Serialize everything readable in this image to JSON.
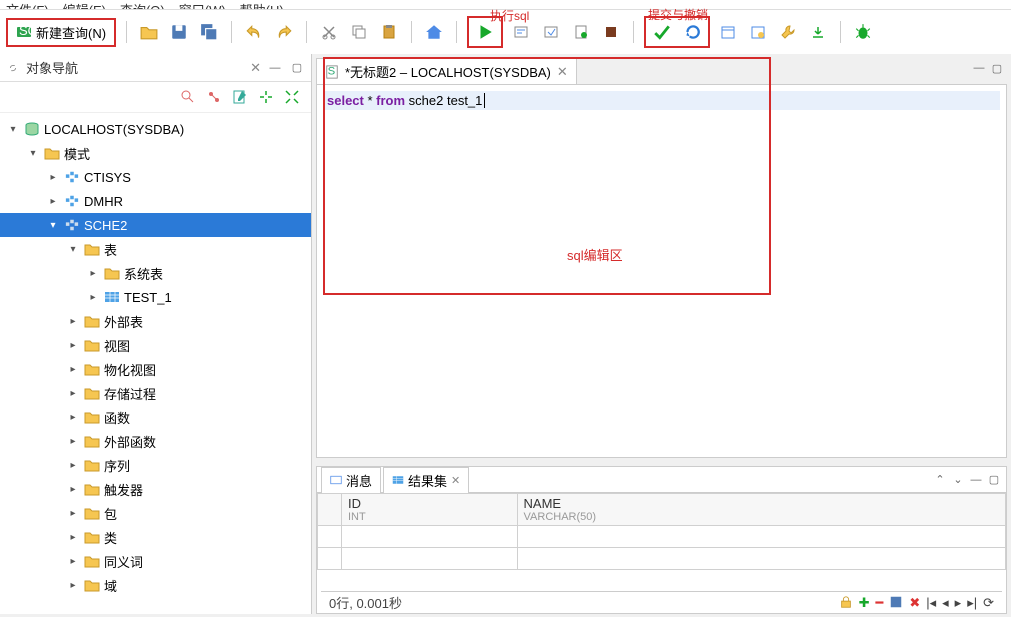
{
  "menu": [
    "文件(F)",
    "编辑(E)",
    "查询(Q)",
    "窗口(W)",
    "帮助(H)"
  ],
  "toolbar": {
    "new_query": "新建查询(N)"
  },
  "annotations": {
    "exec": "执行sql",
    "commit": "提交与撤销",
    "editor": "sql编辑区"
  },
  "nav": {
    "title": "对象导航",
    "root": "LOCALHOST(SYSDBA)",
    "schema_group": "模式",
    "schemas": [
      "CTISYS",
      "DMHR",
      "SCHE2"
    ],
    "selected_schema": "SCHE2",
    "tables_group": "表",
    "tables": [
      "系统表",
      "TEST_1"
    ],
    "folders": [
      "外部表",
      "视图",
      "物化视图",
      "存储过程",
      "函数",
      "外部函数",
      "序列",
      "触发器",
      "包",
      "类",
      "同义词",
      "域"
    ]
  },
  "editor": {
    "tab_title": "*无标题2 – LOCALHOST(SYSDBA)",
    "sql_kw1": "select",
    "sql_mid": " * ",
    "sql_kw2": "from",
    "sql_rest": " sche2 test_1"
  },
  "results": {
    "tabs": [
      "消息",
      "结果集"
    ],
    "columns": [
      {
        "name": "ID",
        "type": "INT"
      },
      {
        "name": "NAME",
        "type": "VARCHAR(50)"
      }
    ],
    "status": "0行, 0.001秒"
  }
}
